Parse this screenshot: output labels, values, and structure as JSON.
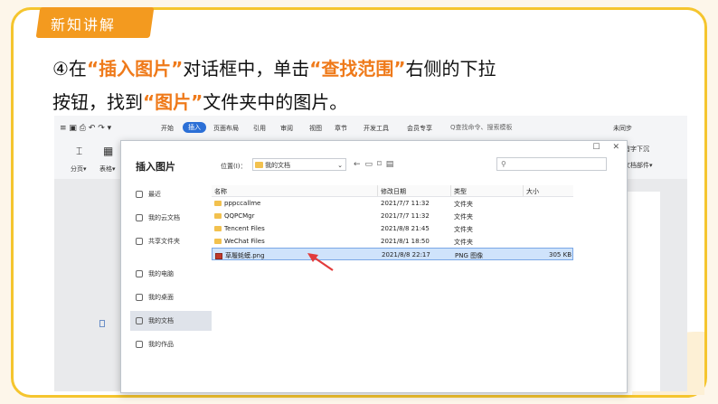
{
  "badge": {
    "text": "新知讲解"
  },
  "instruction": {
    "line1": {
      "prefix": "④在",
      "hl1": "“插入图片”",
      "mid": "对话框中，单击",
      "hl2": "“查找范围”",
      "suffix": "右侧的下拉"
    },
    "line2": {
      "prefix": "按钮，找到",
      "hl1": "“图片”",
      "suffix": "文件夹中的图片。"
    }
  },
  "app": {
    "tabs": [
      "开始",
      "插入",
      "页面布局",
      "引用",
      "审阅",
      "视图",
      "章节",
      "开发工具",
      "会员专享"
    ],
    "active_tab": "插入",
    "search_placeholder": "Q查找命令、搜索模板",
    "sync_label": "未同步",
    "ribbon": {
      "page_label": "分页▾",
      "table_label": "表格▾",
      "first_line_label": "首字下沉",
      "doc_parts_label": "文档部件▾"
    }
  },
  "dialog": {
    "title": "插入图片",
    "location_label": "位置(I)：",
    "location_value": "我的文档",
    "sidebar": [
      {
        "label": "最近"
      },
      {
        "label": "我的云文档"
      },
      {
        "label": "共享文件夹"
      },
      {
        "label": "我的电脑"
      },
      {
        "label": "我的桌面"
      },
      {
        "label": "我的文档"
      },
      {
        "label": "我的作品"
      }
    ],
    "active_sidebar": "我的文档",
    "columns": [
      "名称",
      "修改日期",
      "类型",
      "大小"
    ],
    "files": [
      {
        "name": "pppccallme",
        "date": "2021/7/7 11:32",
        "type": "文件夹",
        "size": "",
        "kind": "folder"
      },
      {
        "name": "QQPCMgr",
        "date": "2021/7/7 11:32",
        "type": "文件夹",
        "size": "",
        "kind": "folder"
      },
      {
        "name": "Tencent Files",
        "date": "2021/8/8 21:45",
        "type": "文件夹",
        "size": "",
        "kind": "folder"
      },
      {
        "name": "WeChat Files",
        "date": "2021/8/1 18:50",
        "type": "文件夹",
        "size": "",
        "kind": "folder"
      },
      {
        "name": "草履蚝蟆.png",
        "date": "2021/8/8 22:17",
        "type": "PNG 图像",
        "size": "305 KB",
        "kind": "image",
        "selected": true
      }
    ]
  },
  "colors": {
    "accent": "#f39a1f",
    "frame": "#f5c52e",
    "highlight_text": "#ef7a1a",
    "arrow": "#e23b3b",
    "selection": "#cfe3fb"
  }
}
